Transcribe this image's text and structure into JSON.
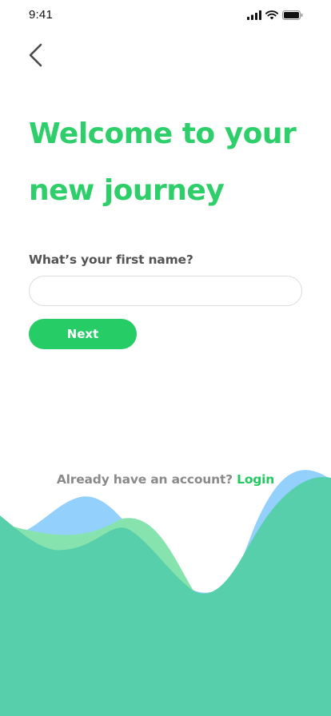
{
  "status_bar": {
    "time": "9:41",
    "icons": [
      "cellular-signal-icon",
      "wifi-icon",
      "battery-icon"
    ]
  },
  "nav": {
    "back_icon": "chevron-left-icon"
  },
  "welcome": {
    "title_line_1": "Welcome to your",
    "title_line_2": "new journey"
  },
  "form": {
    "name_label": "What’s your first name?",
    "name_value": "",
    "name_placeholder": "",
    "next_label": "Next"
  },
  "footer": {
    "account_text": "Already have an account?",
    "login_label": "Login"
  },
  "colors": {
    "brand_green": "#2ecf6a",
    "button_green": "#26cc66",
    "wave_blue": "#93d0fc",
    "wave_light_green": "#87e3ae",
    "wave_teal": "#57cfaa"
  }
}
